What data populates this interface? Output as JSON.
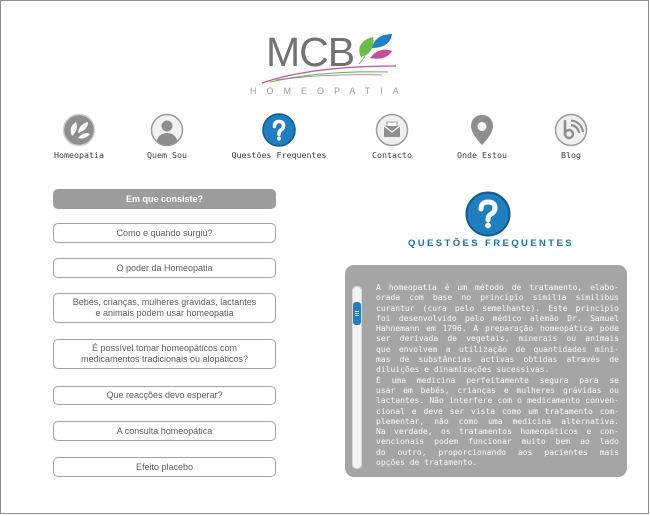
{
  "logo": {
    "text": "MCB",
    "subtitle": "HOMEOPATIA"
  },
  "nav": [
    {
      "label": "Homeopatia",
      "icon": "leaves-icon"
    },
    {
      "label": "Quem Sou",
      "icon": "person-icon"
    },
    {
      "label": "Questões Frequentes",
      "icon": "question-icon",
      "active": true
    },
    {
      "label": "Contacto",
      "icon": "envelope-icon"
    },
    {
      "label": "Onde Estou",
      "icon": "location-pin-icon"
    },
    {
      "label": "Blog",
      "icon": "blog-icon"
    }
  ],
  "faq": {
    "items": [
      {
        "label": "Em que consiste?",
        "active": true
      },
      {
        "label": "Como e quando surgiu?"
      },
      {
        "label": "O poder da Homeopatia"
      },
      {
        "label": "Bebés, crianças, mulheres grávidas, lactantes\ne animais podem usar homeopatia"
      },
      {
        "label": "É possível tomar homeopáticos com\nmedicamentos tradicionais ou alopáticos?"
      },
      {
        "label": "Que reacções devo esperar?"
      },
      {
        "label": "A consulta homeopática"
      },
      {
        "label": "Efeito placebo"
      }
    ]
  },
  "section": {
    "title": "QUESTÕES FREQUENTES",
    "icon": "question-icon"
  },
  "article": {
    "scroll_position": 0.1,
    "lines": [
      "A homeopatia é um método de tratamento, elabo-",
      "orada com base no princípio similia similibus",
      "curantur (cura pelo semelhante). Este princípio",
      "foi desenvolvido pelo médico alemão Dr. Samuel",
      "Hahnemann em 1796. A preparação homeopática pode",
      "ser derivada de vegetais, minerais ou animais",
      "que envolvem a utilização de quantidades míni-",
      "mas de substâncias activas obtidas através de",
      "diluições e dinamizações sucessivas.",
      "É uma medicina perfeitamente segura para se",
      "usar em bebés, crianças e mulheres grávidas ou",
      "lactantes. Não interfere com o medicamento conven-",
      "cional e deve ser vista como um tratamento com-",
      "plementar, não como uma medicina alternativa.",
      "Na verdade, os tratamentos homeopáticos e con-",
      "vencionais podem funcionar muito bem ao lado",
      "do outro, proporcionando aos pacientes mais",
      "opções de tratamento."
    ]
  },
  "colors": {
    "accent": "#1f7fc1",
    "accent_dark": "#135b8e",
    "button_active": "#9d9d9d",
    "panel": "#a5a5a5",
    "leaf_green": "#6cbd45",
    "leaf_blue": "#1f80c4",
    "leaf_pink": "#c2509a",
    "icon_gray": "#8e8e8e"
  }
}
